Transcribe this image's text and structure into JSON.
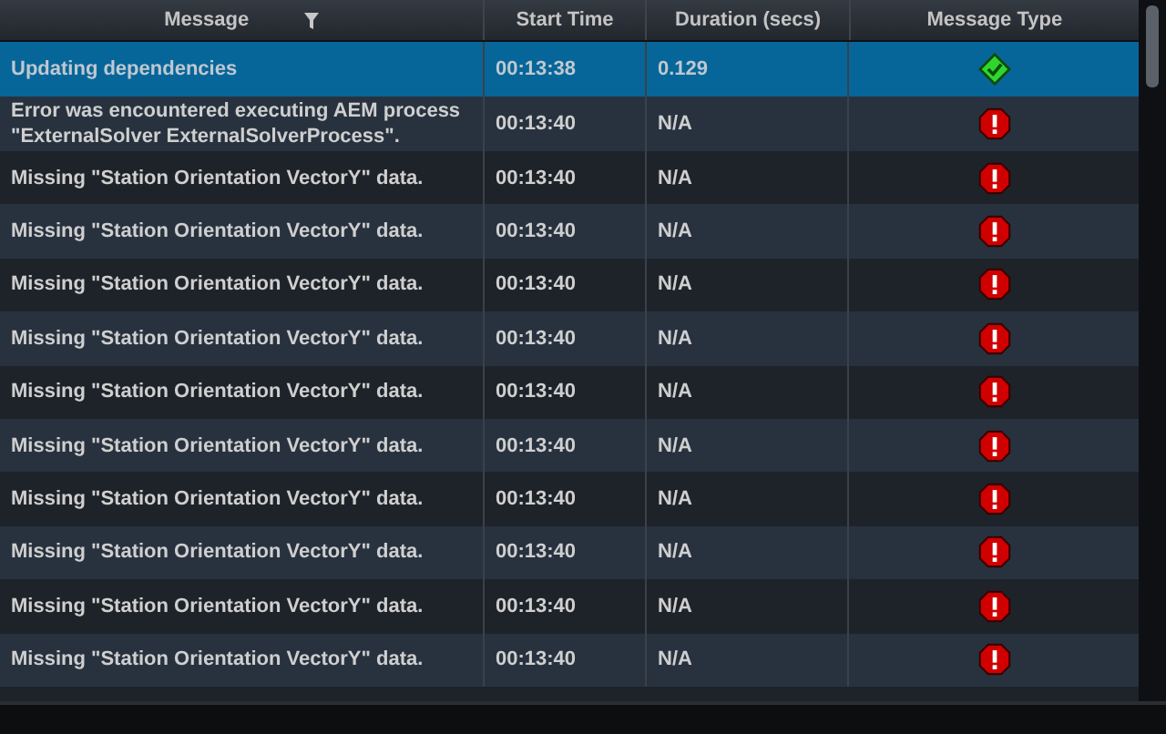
{
  "table": {
    "columns": [
      {
        "label": "Message",
        "filter": true
      },
      {
        "label": "Start Time",
        "filter": false
      },
      {
        "label": "Duration (secs)",
        "filter": false
      },
      {
        "label": "Message Type",
        "filter": false
      }
    ],
    "rows": [
      {
        "message": "Updating dependencies",
        "start": "00:13:38",
        "duration": "0.129",
        "kind": "success",
        "selected": true
      },
      {
        "message": "Error was encountered executing AEM process \"ExternalSolver ExternalSolverProcess\".",
        "start": "00:13:40",
        "duration": "N/A",
        "kind": "error",
        "selected": false
      },
      {
        "message": "Missing \"Station Orientation VectorY\" data.",
        "start": "00:13:40",
        "duration": "N/A",
        "kind": "error",
        "selected": false
      },
      {
        "message": "Missing \"Station Orientation VectorY\" data.",
        "start": "00:13:40",
        "duration": "N/A",
        "kind": "error",
        "selected": false
      },
      {
        "message": "Missing \"Station Orientation VectorY\" data.",
        "start": "00:13:40",
        "duration": "N/A",
        "kind": "error",
        "selected": false
      },
      {
        "message": "Missing \"Station Orientation VectorY\" data.",
        "start": "00:13:40",
        "duration": "N/A",
        "kind": "error",
        "selected": false
      },
      {
        "message": "Missing \"Station Orientation VectorY\" data.",
        "start": "00:13:40",
        "duration": "N/A",
        "kind": "error",
        "selected": false
      },
      {
        "message": "Missing \"Station Orientation VectorY\" data.",
        "start": "00:13:40",
        "duration": "N/A",
        "kind": "error",
        "selected": false
      },
      {
        "message": "Missing \"Station Orientation VectorY\" data.",
        "start": "00:13:40",
        "duration": "N/A",
        "kind": "error",
        "selected": false
      },
      {
        "message": "Missing \"Station Orientation VectorY\" data.",
        "start": "00:13:40",
        "duration": "N/A",
        "kind": "error",
        "selected": false
      },
      {
        "message": "Missing \"Station Orientation VectorY\" data.",
        "start": "00:13:40",
        "duration": "N/A",
        "kind": "error",
        "selected": false
      },
      {
        "message": "Missing \"Station Orientation VectorY\" data.",
        "start": "00:13:40",
        "duration": "N/A",
        "kind": "error",
        "selected": false
      }
    ]
  }
}
